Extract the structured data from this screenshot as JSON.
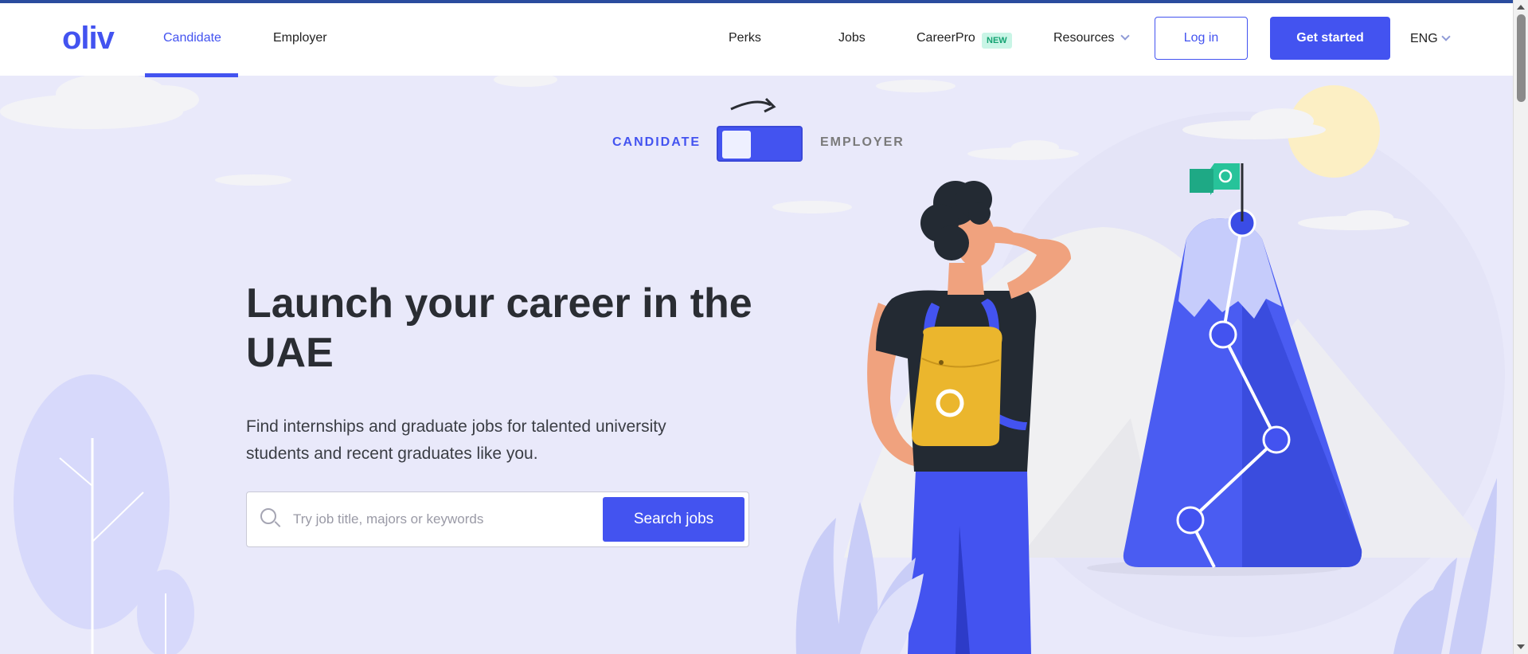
{
  "header": {
    "logo": "oliv",
    "nav_left": [
      "Candidate",
      "Employer"
    ],
    "nav_right": {
      "perks": "Perks",
      "jobs": "Jobs",
      "careerpro": "CareerPro",
      "careerpro_badge": "NEW",
      "resources": "Resources"
    },
    "login": "Log in",
    "get_started": "Get started",
    "language": "ENG"
  },
  "toggle": {
    "left_label": "CANDIDATE",
    "right_label": "EMPLOYER"
  },
  "hero": {
    "title": "Launch your career in the UAE",
    "subtitle": "Find internships and graduate jobs for talented university students and recent graduates like you.",
    "search_placeholder": "Try job title, majors or keywords",
    "search_button": "Search jobs"
  },
  "colors": {
    "brand": "#4353f0",
    "background": "#e9e9fa",
    "text": "#2a2d33",
    "badge_bg": "#c9f5e6",
    "badge_text": "#14a372"
  },
  "icons": [
    "search-icon",
    "chevron-down-icon",
    "arrow-right-icon",
    "flag-icon"
  ]
}
